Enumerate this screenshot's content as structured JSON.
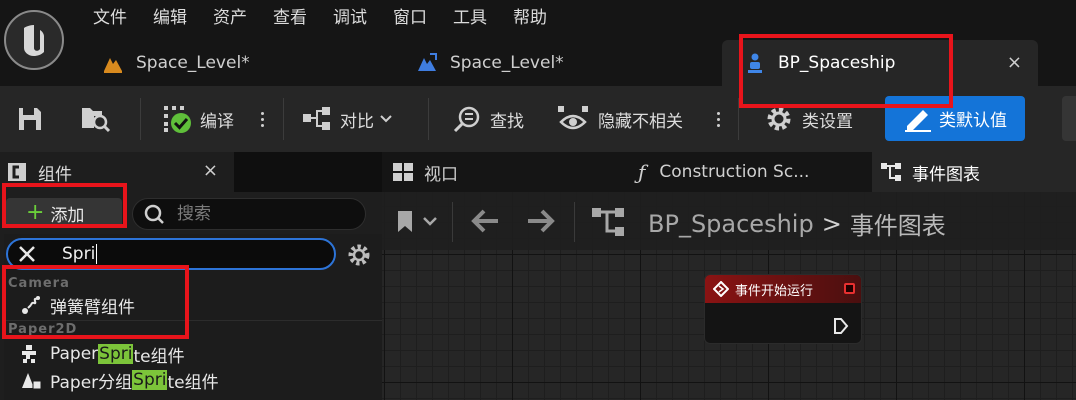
{
  "menu": [
    "文件",
    "编辑",
    "资产",
    "查看",
    "调试",
    "窗口",
    "工具",
    "帮助"
  ],
  "tabs": [
    {
      "label": "Space_Level*"
    },
    {
      "label": "Space_Level*"
    },
    {
      "label": "BP_Spaceship",
      "close": "×"
    }
  ],
  "toolbar": {
    "compile": "编译",
    "diff": "对比",
    "find": "查找",
    "hide_unrelated": "隐藏不相关",
    "class_settings": "类设置",
    "class_defaults": "类默认值"
  },
  "components_panel": {
    "title": "组件",
    "close": "×",
    "add_label": "添加",
    "search_placeholder": "搜索"
  },
  "filter": {
    "value": "Spri"
  },
  "categories": [
    {
      "name": "Camera",
      "items": [
        {
          "label": "弹簧臂组件",
          "pre": "弹簧臂组件",
          "match": "",
          "post": ""
        }
      ]
    },
    {
      "name": "Paper2D",
      "items": [
        {
          "pre": "Paper ",
          "match": "Spri",
          "post": "te组件"
        },
        {
          "pre": "Paper分组 ",
          "match": "Spri",
          "post": "te组件"
        }
      ]
    }
  ],
  "right_tabs": [
    "视口",
    "Construction Sc...",
    "事件图表"
  ],
  "breadcrumb": {
    "root": "BP_Spaceship",
    "sep": ">",
    "current": "事件图表"
  },
  "node": {
    "title": "事件开始运行"
  },
  "colors": {
    "accent": "#1474d8",
    "highlight": "#7cc43a",
    "annotation": "#e8141b",
    "node_header": "#8a1313"
  }
}
